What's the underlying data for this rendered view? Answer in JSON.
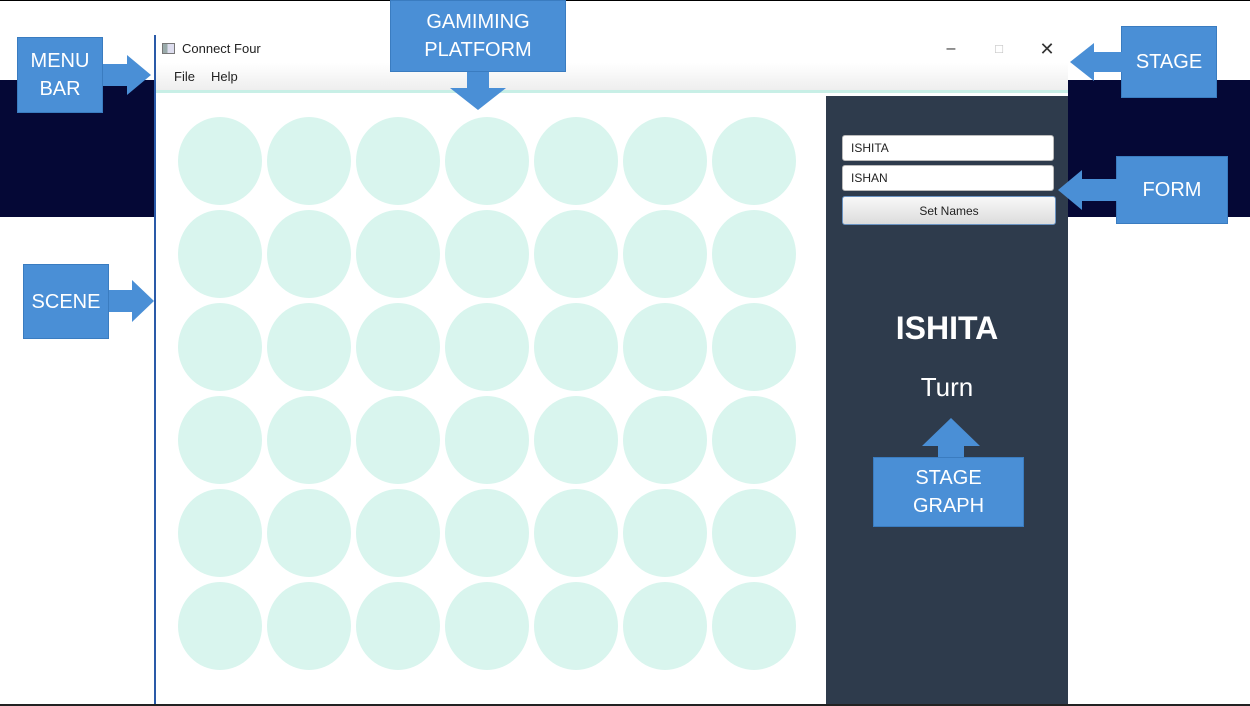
{
  "window": {
    "title": "Connect Four",
    "controls": {
      "minimize": "–",
      "maximize": "□",
      "close": "✕"
    }
  },
  "menu": {
    "file": "File",
    "help": "Help"
  },
  "board": {
    "columns": 7,
    "rows": 6,
    "slot_color": "#d9f5ee"
  },
  "panel": {
    "player_one_value": "ISHITA",
    "player_two_value": "ISHAN",
    "set_names_label": "Set Names",
    "current_player": "ISHITA",
    "turn_label": "Turn",
    "background": "#2e3b4c"
  },
  "annotations": {
    "menu_bar": "MENU BAR",
    "gaming_platform": "GAMIMING PLATFORM",
    "stage": "STAGE",
    "form": "FORM",
    "scene": "SCENE",
    "stage_graph": "STAGE GRAPH",
    "callout_color": "#4a8fd6"
  }
}
